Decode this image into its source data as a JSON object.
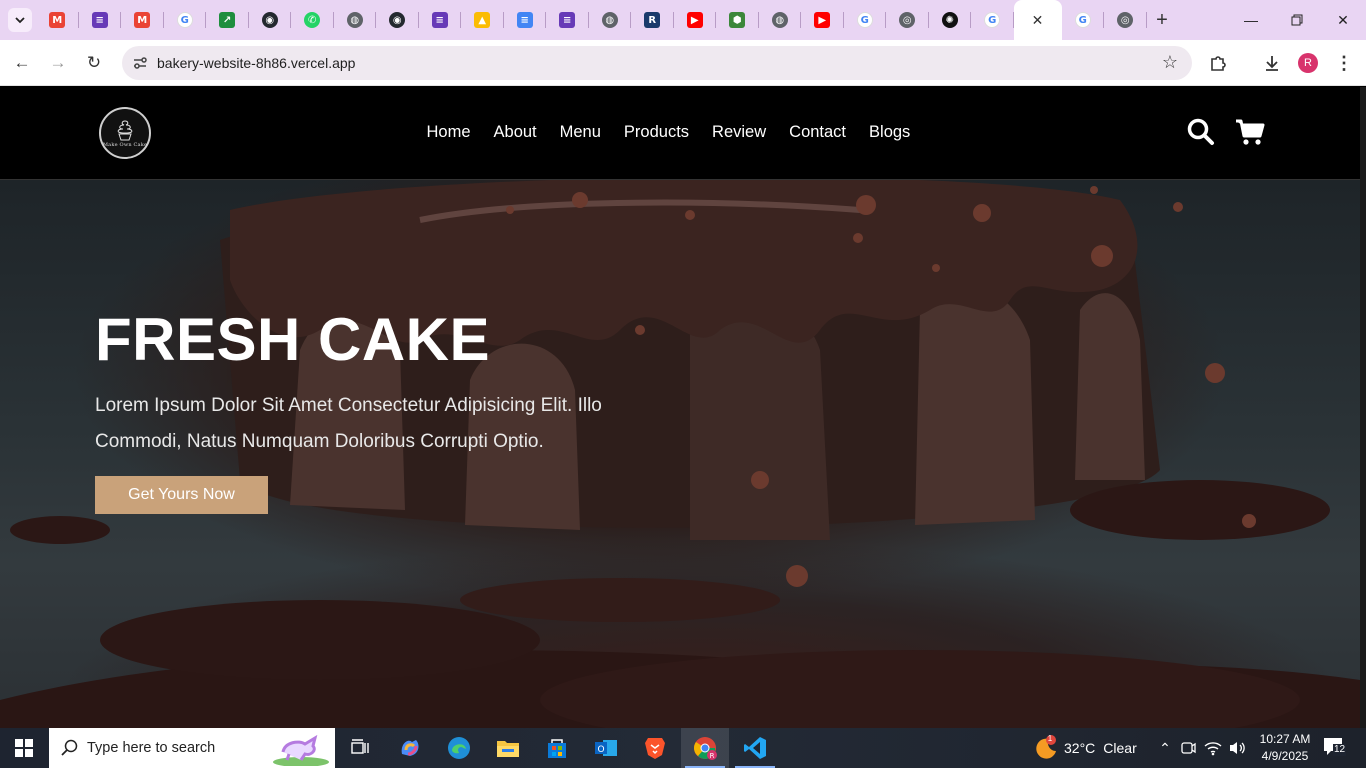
{
  "browser": {
    "tabs": [
      {
        "icon": "gmail-icon",
        "color": "#ea4335",
        "glyph": "M"
      },
      {
        "icon": "forms-icon",
        "color": "#673ab7",
        "glyph": "≡"
      },
      {
        "icon": "gmail-icon",
        "color": "#ea4335",
        "glyph": "M"
      },
      {
        "icon": "google-icon",
        "color": "#4285f4",
        "glyph": "G"
      },
      {
        "icon": "app-icon",
        "color": "#1e8e3e",
        "glyph": "↗"
      },
      {
        "icon": "github-icon",
        "color": "#24292f",
        "glyph": "◉"
      },
      {
        "icon": "whatsapp-icon",
        "color": "#25d366",
        "glyph": "✆"
      },
      {
        "icon": "globe-icon",
        "color": "#5f6368",
        "glyph": "◍"
      },
      {
        "icon": "github-icon",
        "color": "#24292f",
        "glyph": "◉"
      },
      {
        "icon": "forms-icon",
        "color": "#673ab7",
        "glyph": "≡"
      },
      {
        "icon": "drive-icon",
        "color": "#fbbc04",
        "glyph": "▲"
      },
      {
        "icon": "docs-icon",
        "color": "#4285f4",
        "glyph": "≡"
      },
      {
        "icon": "forms-icon",
        "color": "#673ab7",
        "glyph": "≡"
      },
      {
        "icon": "globe-icon",
        "color": "#5f6368",
        "glyph": "◍"
      },
      {
        "icon": "r-icon",
        "color": "#1a3a6b",
        "glyph": "R"
      },
      {
        "icon": "youtube-icon",
        "color": "#ff0000",
        "glyph": "▶"
      },
      {
        "icon": "node-icon",
        "color": "#3c873a",
        "glyph": "⬢"
      },
      {
        "icon": "globe-icon",
        "color": "#5f6368",
        "glyph": "◍"
      },
      {
        "icon": "youtube-icon",
        "color": "#ff0000",
        "glyph": "▶"
      },
      {
        "icon": "google-icon",
        "color": "#4285f4",
        "glyph": "G"
      },
      {
        "icon": "chrome-icon",
        "color": "#5f6368",
        "glyph": "◎"
      },
      {
        "icon": "openai-icon",
        "color": "#111111",
        "glyph": "✺"
      },
      {
        "icon": "google-icon",
        "color": "#4285f4",
        "glyph": "G"
      },
      {
        "icon": "close-icon",
        "color": "#333333",
        "glyph": "✕",
        "active": true
      },
      {
        "icon": "google-icon",
        "color": "#4285f4",
        "glyph": "G"
      },
      {
        "icon": "chrome-icon",
        "color": "#5f6368",
        "glyph": "◎"
      }
    ],
    "url": "bakery-website-8h86.vercel.app",
    "profile_initial": "R"
  },
  "site": {
    "logo_text": "Make Own Cake",
    "nav": [
      "Home",
      "About",
      "Menu",
      "Products",
      "Review",
      "Contact",
      "Blogs"
    ],
    "hero": {
      "title": "FRESH CAKE",
      "text": "Lorem Ipsum Dolor Sit Amet Consectetur Adipisicing Elit. Illo Commodi, Natus Numquam Doloribus Corrupti Optio.",
      "button": "Get Yours Now"
    },
    "accent": "#c9a27a"
  },
  "taskbar": {
    "search_placeholder": "Type here to search",
    "weather_temp": "32°C",
    "weather_desc": "Clear",
    "weather_badge": "1",
    "time": "10:27 AM",
    "date": "4/9/2025",
    "notifications": "12"
  }
}
